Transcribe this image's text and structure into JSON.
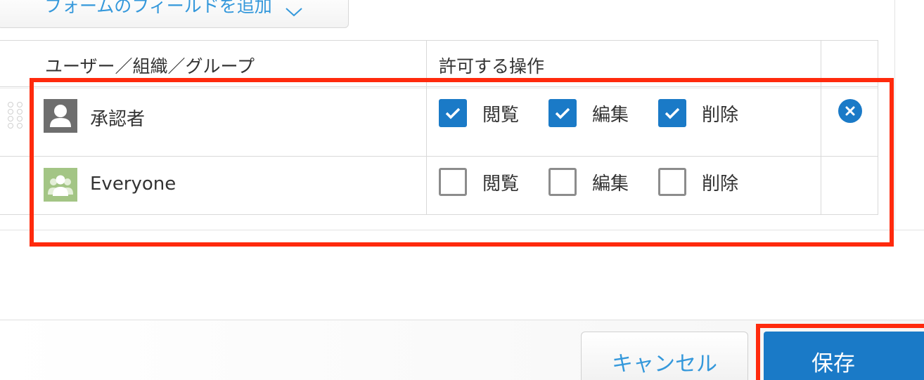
{
  "toolbar": {
    "add_field_label": "フォームのフィールドを追加"
  },
  "table": {
    "headers": {
      "entity": "ユーザー／組織／グループ",
      "actions": "許可する操作"
    },
    "rows": [
      {
        "name": "承認者",
        "icon": "user-icon",
        "permissions": [
          {
            "label": "閲覧",
            "checked": true
          },
          {
            "label": "編集",
            "checked": true
          },
          {
            "label": "削除",
            "checked": true
          }
        ],
        "removable": true
      },
      {
        "name": "Everyone",
        "icon": "group-icon",
        "permissions": [
          {
            "label": "閲覧",
            "checked": false
          },
          {
            "label": "編集",
            "checked": false
          },
          {
            "label": "削除",
            "checked": false
          }
        ],
        "removable": false
      }
    ]
  },
  "footer": {
    "cancel_label": "キャンセル",
    "save_label": "保存"
  },
  "colors": {
    "accent": "#1a7ac7",
    "link": "#3498db",
    "highlight": "#ff2a0d",
    "user_avatar": "#6e6e6e",
    "group_avatar": "#a3c585"
  }
}
